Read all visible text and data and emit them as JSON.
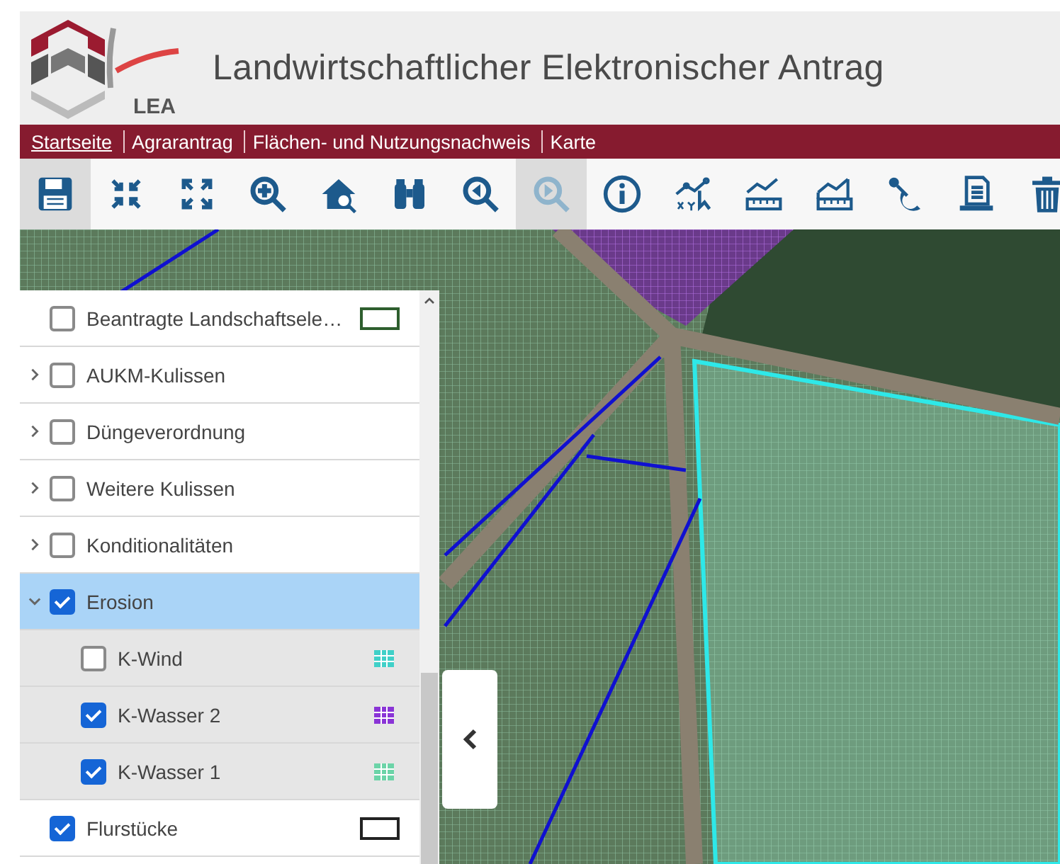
{
  "header": {
    "logo_text": "LEA",
    "title": "Landwirtschaftlicher Elektronischer Antrag"
  },
  "nav": [
    {
      "label": "Startseite",
      "selected": true
    },
    {
      "label": "Agrarantrag",
      "selected": false
    },
    {
      "label": "Flächen- und Nutzungsnachweis",
      "selected": false
    },
    {
      "label": "Karte",
      "selected": false
    }
  ],
  "toolbar": [
    {
      "kind": "save",
      "selected": true,
      "disabled": false
    },
    {
      "kind": "collapse",
      "selected": false,
      "disabled": false
    },
    {
      "kind": "expand",
      "selected": false,
      "disabled": false
    },
    {
      "kind": "zoom-in",
      "selected": false,
      "disabled": false
    },
    {
      "kind": "home-zoom",
      "selected": false,
      "disabled": false
    },
    {
      "kind": "binoculars",
      "selected": false,
      "disabled": false
    },
    {
      "kind": "zoom-back",
      "selected": false,
      "disabled": false
    },
    {
      "kind": "zoom-forward",
      "selected": true,
      "disabled": true
    },
    {
      "kind": "info",
      "selected": false,
      "disabled": false
    },
    {
      "kind": "measure-xy",
      "selected": false,
      "disabled": false
    },
    {
      "kind": "measure-line",
      "selected": false,
      "disabled": false
    },
    {
      "kind": "measure-area",
      "selected": false,
      "disabled": false
    },
    {
      "kind": "snap",
      "selected": false,
      "disabled": false
    },
    {
      "kind": "print",
      "selected": false,
      "disabled": false
    },
    {
      "kind": "delete",
      "selected": false,
      "disabled": false
    }
  ],
  "layers": [
    {
      "kind": "outline-layer",
      "label": "Beantragte Landschaftsele…",
      "checked": false,
      "selected": false,
      "color": "#2e5e2e"
    },
    {
      "kind": "group",
      "label": "AUKM-Kulissen",
      "checked": false,
      "selected": false,
      "expanded": false
    },
    {
      "kind": "group",
      "label": "Düngeverordnung",
      "checked": false,
      "selected": false,
      "expanded": false
    },
    {
      "kind": "group",
      "label": "Weitere Kulissen",
      "checked": false,
      "selected": false,
      "expanded": false
    },
    {
      "kind": "group",
      "label": "Konditionalitäten",
      "checked": false,
      "selected": false,
      "expanded": false
    },
    {
      "kind": "group",
      "label": "Erosion",
      "checked": true,
      "selected": true,
      "expanded": true,
      "children": [
        {
          "kind": "grid-layer",
          "label": "K-Wind",
          "checked": false,
          "selected": false,
          "color": "#40d0c8"
        },
        {
          "kind": "grid-layer",
          "label": "K-Wasser 2",
          "checked": true,
          "selected": false,
          "color": "#8a34d6"
        },
        {
          "kind": "grid-layer",
          "label": "K-Wasser 1",
          "checked": true,
          "selected": false,
          "color": "#6cd4a8"
        }
      ]
    },
    {
      "kind": "outline-layer",
      "label": "Flurstücke",
      "checked": true,
      "selected": false,
      "color": "#222222"
    }
  ]
}
